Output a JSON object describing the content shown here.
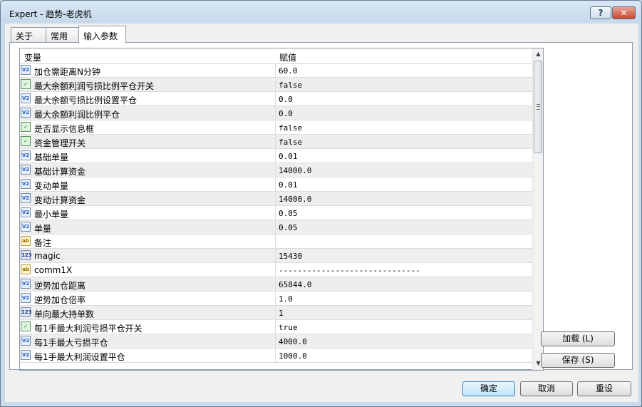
{
  "window": {
    "title": "Expert - 趋势-老虎机",
    "help_label": "?",
    "close_label": "✕"
  },
  "tabs": [
    {
      "label": "关于"
    },
    {
      "label": "常用"
    },
    {
      "label": "输入参数"
    }
  ],
  "grid": {
    "col_variable": "变量",
    "col_value": "赋值",
    "rows": [
      {
        "name": "加仓需距离N分钟",
        "value": "60.0",
        "type": "dbl"
      },
      {
        "name": "最大余额利润亏损比例平仓开关",
        "value": "false",
        "type": "bool"
      },
      {
        "name": "最大余额亏损比例设置平仓",
        "value": "0.0",
        "type": "dbl"
      },
      {
        "name": "最大余额利润比例平仓",
        "value": "0.0",
        "type": "dbl"
      },
      {
        "name": "是否显示信息框",
        "value": "false",
        "type": "bool"
      },
      {
        "name": "资金管理开关",
        "value": "false",
        "type": "bool"
      },
      {
        "name": "基础单量",
        "value": "0.01",
        "type": "dbl"
      },
      {
        "name": "基础计算资金",
        "value": "14000.0",
        "type": "dbl"
      },
      {
        "name": "变动单量",
        "value": "0.01",
        "type": "dbl"
      },
      {
        "name": "变动计算资金",
        "value": "14000.0",
        "type": "dbl"
      },
      {
        "name": "最小单量",
        "value": "0.05",
        "type": "dbl"
      },
      {
        "name": "单量",
        "value": "0.05",
        "type": "dbl"
      },
      {
        "name": "备注",
        "value": "",
        "type": "str"
      },
      {
        "name": "magic",
        "value": "15430",
        "type": "int"
      },
      {
        "name": "comm1X",
        "value": "------------------------------",
        "type": "str"
      },
      {
        "name": "逆势加仓距离",
        "value": "65844.0",
        "type": "dbl"
      },
      {
        "name": "逆势加仓倍率",
        "value": "1.0",
        "type": "dbl"
      },
      {
        "name": "单向最大持单数",
        "value": "1",
        "type": "int"
      },
      {
        "name": "每1手最大利润亏损平仓开关",
        "value": "true",
        "type": "bool"
      },
      {
        "name": "每1手最大亏损平仓",
        "value": "4000.0",
        "type": "dbl"
      },
      {
        "name": "每1手最大利润设置平仓",
        "value": "1000.0",
        "type": "dbl"
      }
    ]
  },
  "icons": {
    "dbl": "V2",
    "bool": "✓",
    "str": "ab",
    "int": "123"
  },
  "side_buttons": {
    "load_label": "加载 (L)",
    "save_label": "保存 (S)"
  },
  "footer_buttons": {
    "ok_label": "确定",
    "cancel_label": "取消",
    "reset_label": "重设"
  }
}
